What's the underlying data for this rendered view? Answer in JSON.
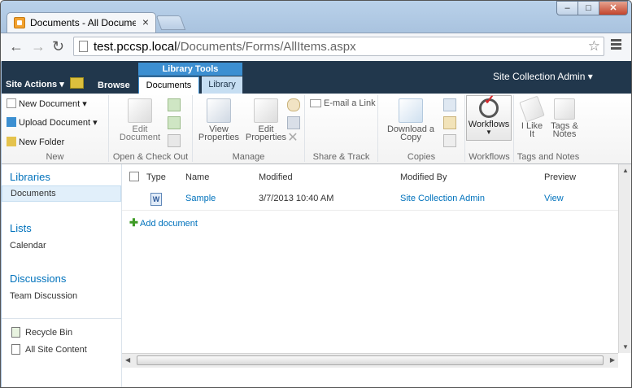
{
  "browser": {
    "tab_title": "Documents - All Documer",
    "tab_close": "×",
    "url_host": "test.pccsp.local",
    "url_path": "/Documents/Forms/AllItems.aspx",
    "min": "–",
    "max": "□",
    "close": "✕",
    "back": "←",
    "forward": "→",
    "reload": "↻",
    "star": "☆"
  },
  "ribbon_bar": {
    "site_actions": "Site Actions ▾",
    "browse": "Browse",
    "library_tools": "Library Tools",
    "tab_documents": "Documents",
    "tab_library": "Library",
    "user": "Site Collection Admin ▾"
  },
  "ribbon": {
    "new_document": "New Document ▾",
    "upload_document": "Upload Document ▾",
    "new_folder": "New Folder",
    "group_new": "New",
    "edit_document_1": "Edit",
    "edit_document_2": "Document",
    "group_open": "Open & Check Out",
    "view_properties_1": "View",
    "view_properties_2": "Properties",
    "edit_properties_1": "Edit",
    "edit_properties_2": "Properties",
    "group_manage": "Manage",
    "email_link": "E-mail a Link",
    "group_share": "Share & Track",
    "download_copy_1": "Download a",
    "download_copy_2": "Copy",
    "group_copies": "Copies",
    "workflows": "Workflows",
    "group_workflows": "Workflows",
    "ilike_1": "I Like",
    "ilike_2": "It",
    "tags_1": "Tags &",
    "tags_2": "Notes",
    "group_tags": "Tags and Notes"
  },
  "left_nav": {
    "libraries": "Libraries",
    "documents": "Documents",
    "lists": "Lists",
    "calendar": "Calendar",
    "discussions": "Discussions",
    "team_discussion": "Team Discussion",
    "recycle_bin": "Recycle Bin",
    "all_site_content": "All Site Content"
  },
  "list": {
    "headers": {
      "type": "Type",
      "name": "Name",
      "modified": "Modified",
      "modified_by": "Modified By",
      "preview": "Preview"
    },
    "rows": [
      {
        "name": "Sample",
        "modified": "3/7/2013 10:40 AM",
        "modified_by": "Site Collection Admin",
        "preview": "View"
      }
    ],
    "add_document": "Add document"
  },
  "colors": {
    "ribbon_dark": "#21374c",
    "accent_blue": "#3c8fd1",
    "link": "#0072bc"
  }
}
